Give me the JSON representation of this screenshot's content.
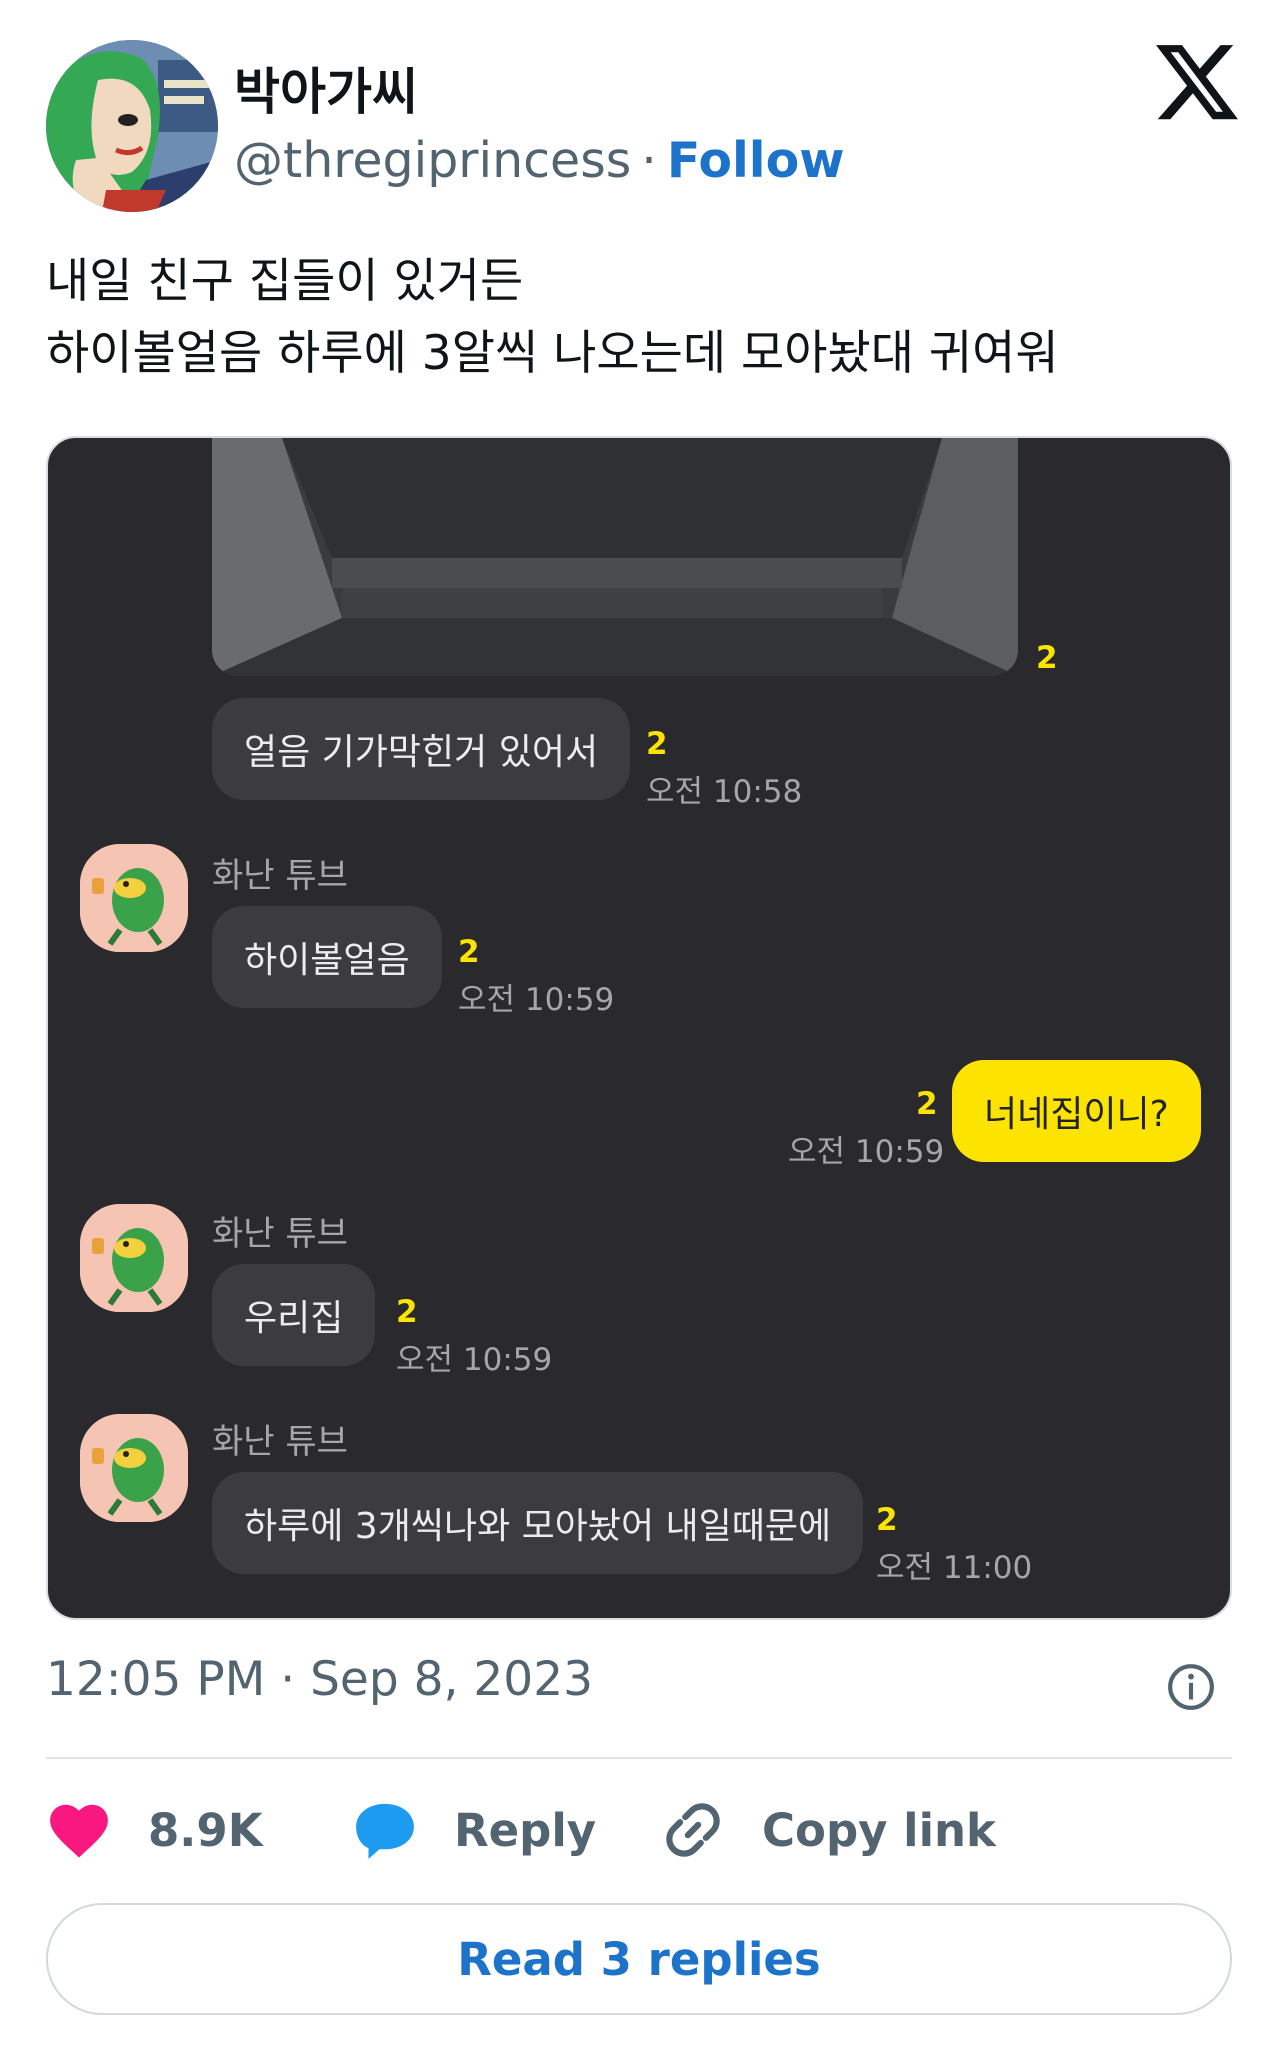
{
  "author": {
    "display_name": "박아가씨",
    "handle": "@thregiprincess",
    "separator": "·",
    "follow_label": "Follow"
  },
  "tweet": {
    "lines": [
      "내일 친구 집들이 있거든",
      "하이볼얼음 하루에 3알씩 나오는데 모아놨대 귀여워"
    ],
    "timestamp": "12:05 PM · Sep 8, 2023"
  },
  "chat": {
    "photo_unread": "2",
    "messages": [
      {
        "sender": "",
        "text": "얼음 기가막힌거 있어서",
        "unread": "2",
        "time": "오전 10:58"
      },
      {
        "sender": "화난 튜브",
        "text": "하이볼얼음",
        "unread": "2",
        "time": "오전 10:59"
      },
      {
        "sender": "",
        "text": "너네집이니?",
        "unread": "2",
        "time": "오전 10:59"
      },
      {
        "sender": "화난 튜브",
        "text": "우리집",
        "unread": "2",
        "time": "오전 10:59"
      },
      {
        "sender": "화난 튜브",
        "text": "하루에 3개씩나와 모아놨어 내일때문에",
        "unread": "2",
        "time": "오전 11:00"
      }
    ],
    "colors": {
      "background": "#2a2a2e",
      "bubble": "#3c3c40",
      "my_bubble": "#fde400",
      "unread": "#fde400"
    }
  },
  "actions": {
    "like_count": "8.9K",
    "reply_label": "Reply",
    "copy_link_label": "Copy link",
    "read_replies_label": "Read 3 replies"
  },
  "icons": [
    "x-logo-icon",
    "info-icon",
    "heart-icon",
    "speech-bubble-icon",
    "link-icon"
  ],
  "colors": {
    "link": "#1d73c9",
    "like": "#f91880",
    "reply_icon": "#1d9bf0",
    "muted": "#536471"
  }
}
